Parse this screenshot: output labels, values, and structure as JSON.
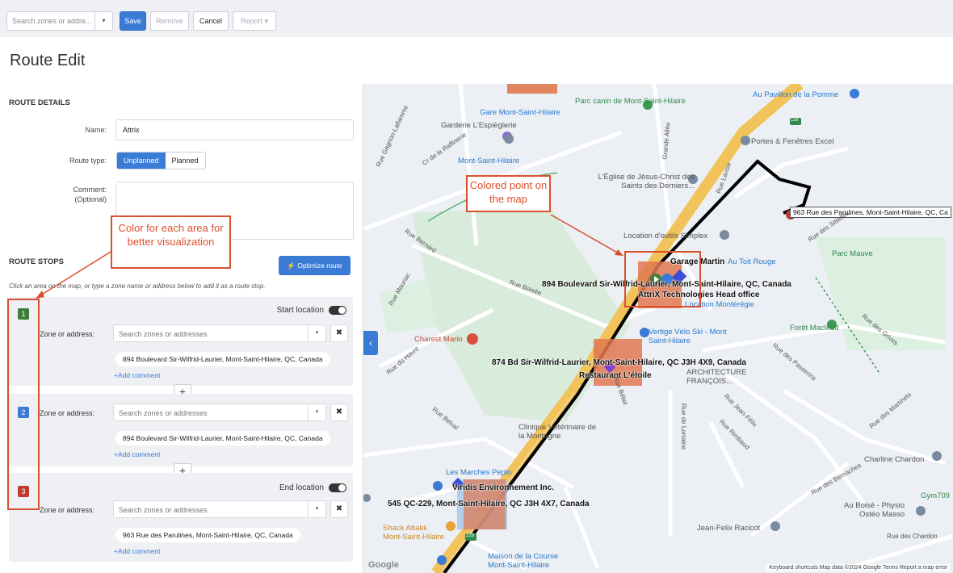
{
  "toolbar": {
    "search_placeholder": "Search zones or addre...",
    "caret": "▾",
    "save_label": "Save",
    "remove_label": "Remove",
    "cancel_label": "Cancel",
    "report_label": "Report ▾"
  },
  "page_title": "Route Edit",
  "route_details": {
    "heading": "ROUTE DETAILS",
    "name_label": "Name:",
    "name_value": "Attrix",
    "route_type_label": "Route type:",
    "route_types": [
      "Unplanned",
      "Planned"
    ],
    "selected_route_type": "Unplanned",
    "comment_label": "Comment:",
    "comment_optional": "(Optional)",
    "comment_value": ""
  },
  "route_stops": {
    "heading": "ROUTE STOPS",
    "optimize_label": "Optimize route",
    "hint": "Click an area on the map, or type a zone name or address below to add it as a route stop.",
    "zone_label": "Zone or address:",
    "zone_placeholder": "Search zones or addresses",
    "add_comment": "+Add comment",
    "start_location": "Start location",
    "end_location": "End location",
    "stops": [
      {
        "number": "1",
        "color": "#3f7d3a",
        "address": "894 Boulevard Sir-Wilfrid-Laurier, Mont-Saint-Hilaire, QC, Canada"
      },
      {
        "number": "2",
        "color": "#3a7bd5",
        "address": "894 Boulevard Sir-Wilfrid-Laurier, Mont-Saint-Hilaire, QC, Canada"
      },
      {
        "number": "3",
        "color": "#c23b2e",
        "address": "963 Rue des Parulines, Mont-Saint-Hilaire, QC, Canada"
      }
    ]
  },
  "annotations": {
    "color_area": "Color for each area for better visualization",
    "colored_point": "Colored point on the map"
  },
  "map": {
    "labels": {
      "gare": "Gare Mont-Saint-Hilaire",
      "parc_canin": "Parc canin de Mont-Saint-Hilaire",
      "garderie": "Garderie L'Espiègleriе",
      "mont_station": "Mont-Saint-Hilaire",
      "pomme": "Au Pavillon de la Pomme",
      "portes": "Portes & Fenêtres Excel",
      "eglise": "L'Église de Jésus-Christ des Saints des Derniers...",
      "location_outils": "Location d'outils Simplex",
      "parc_mauve": "Parc Mauve",
      "garage": "Garage Martin",
      "toit_rouge": "Au Toit Rouge",
      "addr_894": "894 Boulevard Sir-Wilfrid-Laurier, Mont-Saint-Hilaire, QC, Canada",
      "attrix_office": "AttriX Technologies Head office",
      "monteregie": "Location Montérégie",
      "charest": "Charest Mario",
      "vertige": "Vertige Vélo Ski - Mont Saint-Hilaire",
      "foret": "Forêt Macleod",
      "addr_874": "874 Bd Sir-Wilfrid-Laurier, Mont-Saint-Hilaire, QC J3H 4X9, Canada",
      "restaurant": "Restaurant L'étoile",
      "architecture": "ARCHITECTURE FRANÇOIS...",
      "clinique": "Clinique Vétérinaire de la Montagne",
      "marches": "Les Marches Pepin",
      "viridis": "Viridis Environnement Inc.",
      "addr_545": "545 QC-229, Mont-Saint-Hilaire, QC J3H 4X7, Canada",
      "shack": "Shack Attakk Mont-Saint-Hilaire",
      "maison": "Maison de la Course Mont-Saint-Hilaire",
      "charline": "Charline Chardon",
      "gym": "Gym709",
      "au_boise": "Au Boisé - Physio Ostéo Masso",
      "jean_felix": "Jean-Felix Racicot",
      "addr_963": "963 Rue des Parulines, Mont-Saint-Hilaire, QC, Ca",
      "route_116": "116",
      "route_229": "229",
      "google": "Google"
    },
    "streets": [
      "Rue Bernard",
      "Rue Boisée",
      "Rue Mauriac",
      "Rue du Havre",
      "Rue Belval",
      "Rue des Sittelles",
      "Rue Lavoie",
      "Grande Allée",
      "Rue des Grives",
      "Rue des Passerins",
      "Rue Jean-Félix",
      "Rue Rimbaud",
      "Rue de Lorraine",
      "Rue des Bernaches",
      "Rue des Martinets",
      "Rue des Chardon",
      "Cr de la Raffinerie",
      "Rue Gagnon-Laflamme",
      "Rue Bélair"
    ],
    "footer": "Keyboard shortcuts   Map data ©2024 Google   Terms   Report a map error",
    "collapse_icon": "chevron-left-icon"
  },
  "colors": {
    "accent": "#3a7bd5",
    "annotation": "#d9502f",
    "area_fill": "#e07850",
    "route_line": "#000000",
    "highway": "#f2c35a"
  }
}
